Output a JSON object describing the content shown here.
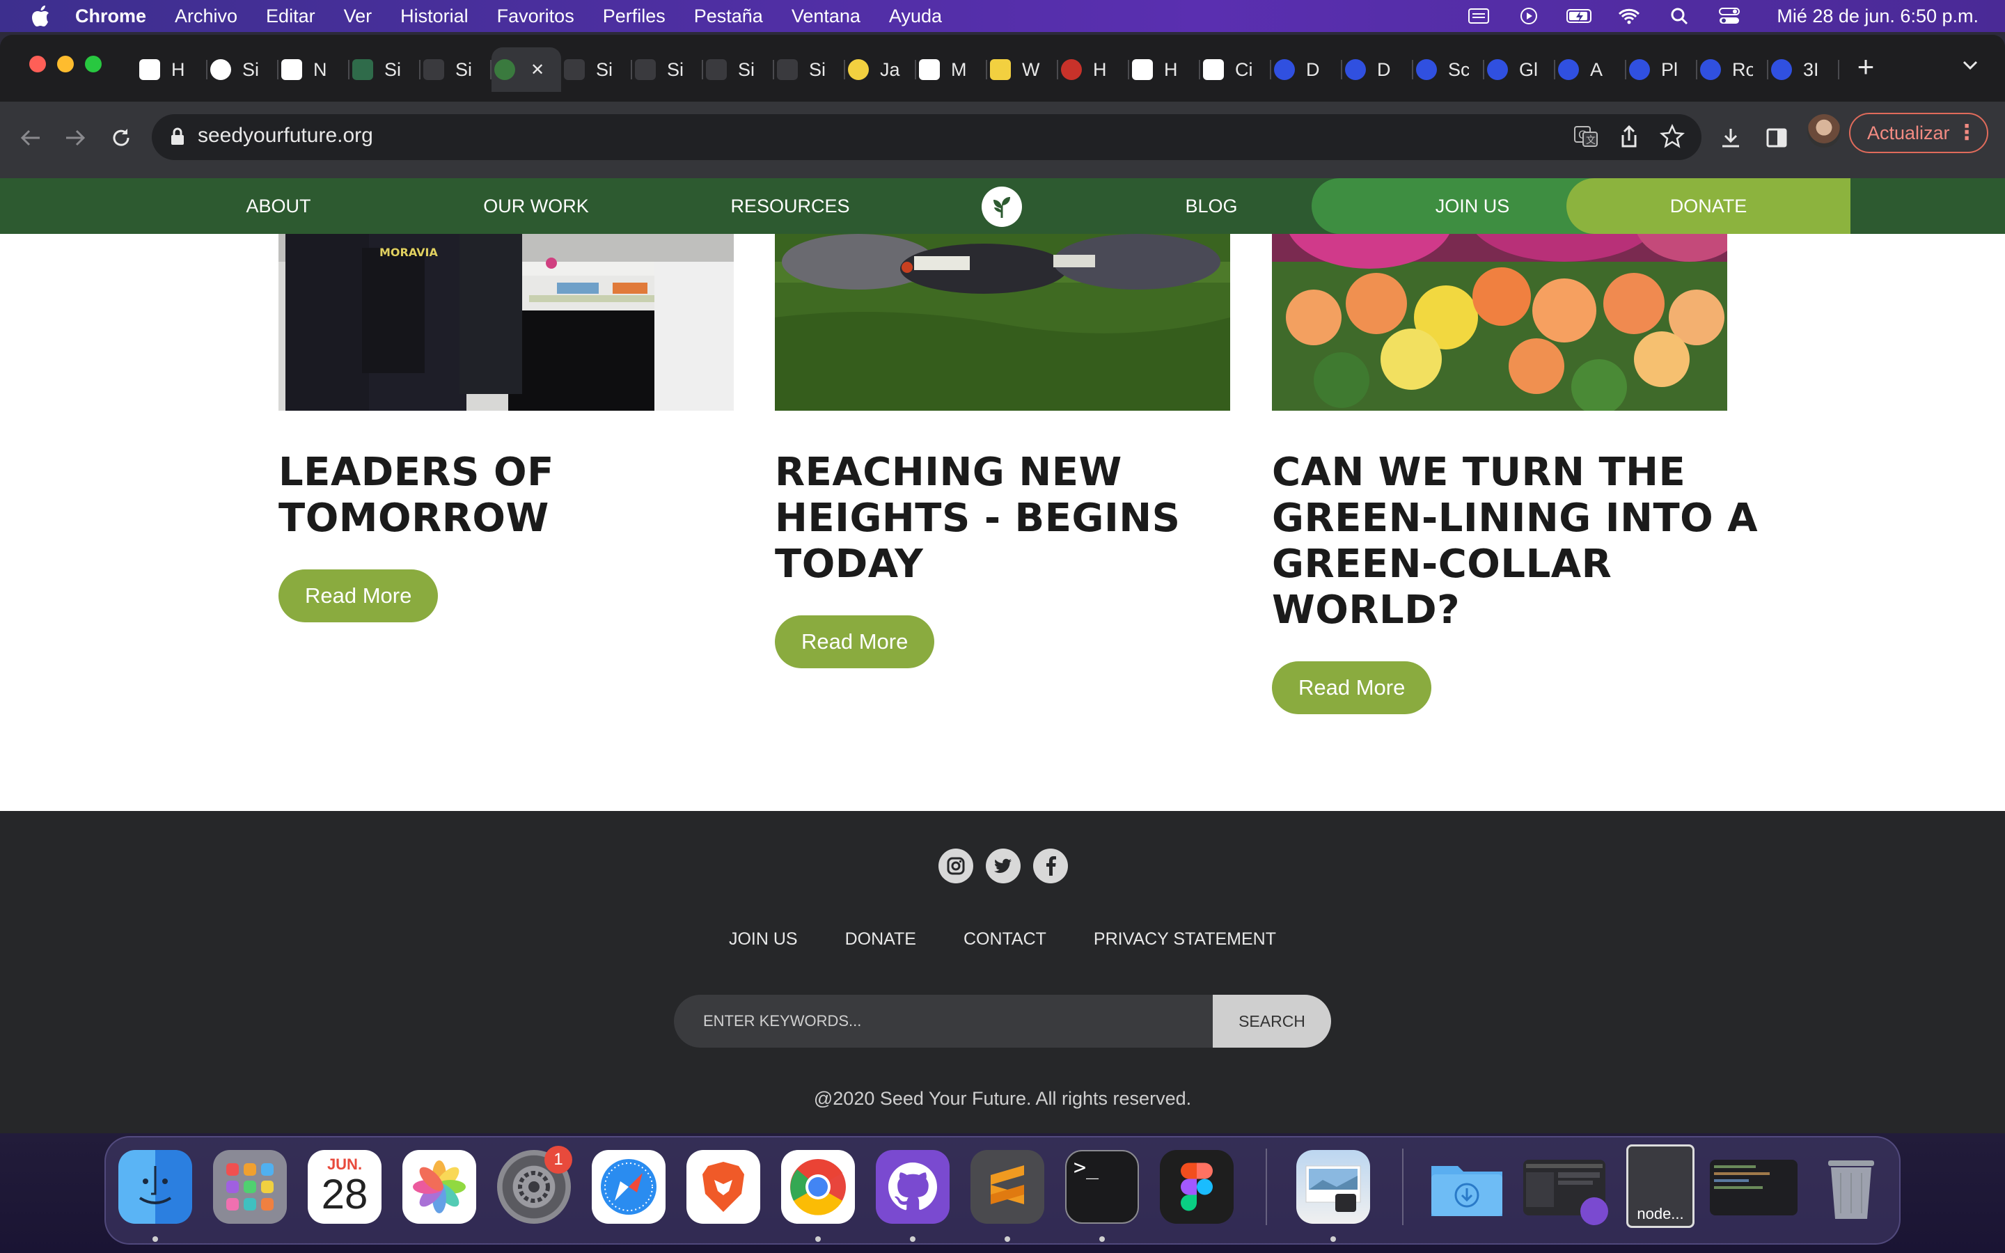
{
  "menubar": {
    "app": "Chrome",
    "items": [
      "Archivo",
      "Editar",
      "Ver",
      "Historial",
      "Favoritos",
      "Perfiles",
      "Pestaña",
      "Ventana",
      "Ayuda"
    ],
    "clock": "Mié 28 de jun.  6:50 p.m."
  },
  "tabs": [
    {
      "label": "H",
      "icon": "vm-icon"
    },
    {
      "label": "Si",
      "icon": "github-icon"
    },
    {
      "label": "N",
      "icon": "n-icon"
    },
    {
      "label": "Si",
      "icon": "s-icon"
    },
    {
      "label": "Si",
      "icon": "swd-icon"
    },
    {
      "label": "",
      "icon": "seed-icon",
      "active": true
    },
    {
      "label": "Si",
      "icon": "swd-icon"
    },
    {
      "label": "Si",
      "icon": "swd-icon"
    },
    {
      "label": "Si",
      "icon": "swd-icon"
    },
    {
      "label": "Si",
      "icon": "swd-icon"
    },
    {
      "label": "Ja",
      "icon": "moon-icon"
    },
    {
      "label": "M",
      "icon": "m-icon"
    },
    {
      "label": "W",
      "icon": "w-icon"
    },
    {
      "label": "H",
      "icon": "red-icon"
    },
    {
      "label": "H",
      "icon": "h-icon"
    },
    {
      "label": "Ci",
      "icon": "c-icon"
    },
    {
      "label": "D",
      "icon": "drop-icon"
    },
    {
      "label": "D",
      "icon": "drop-icon"
    },
    {
      "label": "Sc",
      "icon": "drop-icon"
    },
    {
      "label": "Gl",
      "icon": "drop-icon"
    },
    {
      "label": "A",
      "icon": "drop-icon"
    },
    {
      "label": "Pl",
      "icon": "drop-icon"
    },
    {
      "label": "Ro",
      "icon": "drop-icon"
    },
    {
      "label": "3I",
      "icon": "drop-icon"
    }
  ],
  "toolbar": {
    "url": "seedyourfuture.org",
    "update_label": "Actualizar"
  },
  "site": {
    "nav": {
      "about": "ABOUT",
      "our_work": "OUR WORK",
      "resources": "RESOURCES",
      "blog": "BLOG",
      "join": "JOIN US",
      "donate": "DONATE"
    },
    "cards": [
      {
        "title": "LEADERS OF TOMORROW",
        "button": "Read More"
      },
      {
        "title": "REACHING NEW HEIGHTS - BEGINS TODAY",
        "button": "Read More"
      },
      {
        "title": "CAN WE TURN THE GREEN-LINING INTO A GREEN-COLLAR WORLD?",
        "button": "Read More"
      }
    ],
    "footer": {
      "links": [
        "JOIN US",
        "DONATE",
        "CONTACT",
        "PRIVACY STATEMENT"
      ],
      "search_placeholder": "ENTER KEYWORDS...",
      "search_button": "SEARCH",
      "copyright": "@2020 Seed Your Future. All rights reserved."
    }
  },
  "dock": {
    "calendar_month": "JUN.",
    "calendar_day": "28",
    "settings_badge": "1",
    "node_label": "node..."
  }
}
